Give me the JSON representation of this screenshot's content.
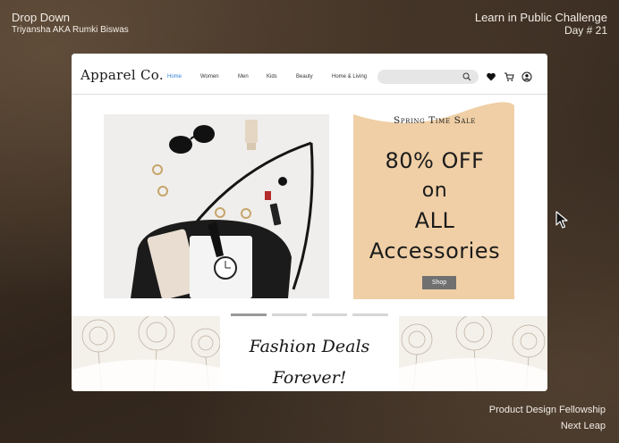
{
  "overlay": {
    "title": "Drop Down",
    "subtitle": "Triyansha AKA Rumki Biswas",
    "challenge": "Learn in Public Challenge",
    "day": "Day # 21",
    "fellowship": "Product Design Fellowship",
    "org": "Next Leap"
  },
  "nav": {
    "logo": "Apparel Co.",
    "links": [
      "Home",
      "Women",
      "Men",
      "Kids",
      "Beauty",
      "Home & Living"
    ],
    "active_link": "Home",
    "search_placeholder": "",
    "icons": [
      "search-icon",
      "heart-icon",
      "cart-icon",
      "account-icon"
    ]
  },
  "hero": {
    "sale_heading": "Spring Time Sale",
    "offer_line1": "80% OFF",
    "offer_line2": "on",
    "offer_line3": "ALL",
    "offer_line4": "Accessories",
    "shop_button": "Shop"
  },
  "carousel": {
    "slides": 4,
    "active_index": 0
  },
  "deals": {
    "line1": "Fashion Deals",
    "line2": "Forever!"
  },
  "colors": {
    "accent": "#2f7fd6",
    "sale_panel": "#f0cfa6",
    "active_dot": "#9a9a9a",
    "inactive_dot": "#d6d6d6",
    "shop_button": "#707070"
  }
}
